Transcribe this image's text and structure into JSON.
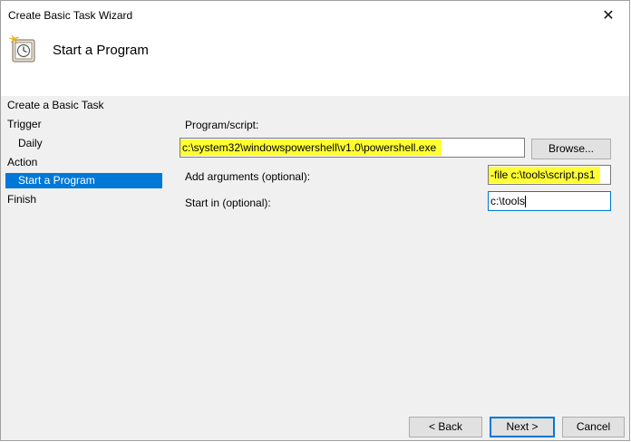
{
  "window": {
    "title": "Create Basic Task Wizard",
    "close_label": "✕"
  },
  "header": {
    "title": "Start a Program"
  },
  "nav": {
    "items": [
      {
        "label": "Create a Basic Task",
        "selected": false
      },
      {
        "label": "Trigger",
        "selected": false
      },
      {
        "label": "Daily",
        "selected": false
      },
      {
        "label": "Action",
        "selected": false
      },
      {
        "label": "Start a Program",
        "selected": true
      },
      {
        "label": "Finish",
        "selected": false
      }
    ]
  },
  "form": {
    "program_label": "Program/script:",
    "program_value": "c:\\system32\\windowspowershell\\v1.0\\powershell.exe",
    "browse_label": "Browse...",
    "arguments_label": "Add arguments (optional):",
    "arguments_value": "-file c:\\tools\\script.ps1",
    "startin_label": "Start in (optional):",
    "startin_value": "c:\\tools"
  },
  "buttons": {
    "back_label": "< Back",
    "next_label": "Next >",
    "cancel_label": "Cancel"
  },
  "colors": {
    "selection": "#0078d7",
    "highlight": "#ffff33"
  }
}
